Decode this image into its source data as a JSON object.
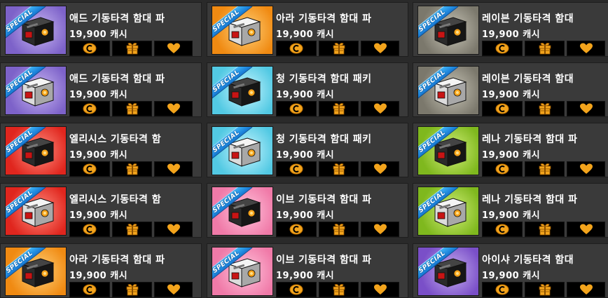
{
  "colors": {
    "accent_gold": "#f3a41c",
    "button_bg": "#000000",
    "card_bg": "#3a3a3a",
    "page_bg": "#2a2a2a",
    "ribbon_blue": "#1f8be3",
    "text_white": "#ffffff"
  },
  "ribbon_label": "SPECIAL",
  "icons": {
    "buy": "cash-coin-icon",
    "gift": "gift-box-icon",
    "wish": "heart-icon"
  },
  "products": [
    {
      "name": "애드 기동타격 함대 파",
      "price": "19,900 캐시",
      "theme": "purple",
      "box": "dark"
    },
    {
      "name": "아라 기동타격 함대 파",
      "price": "19,900 캐시",
      "theme": "orange",
      "box": "light"
    },
    {
      "name": "레이븐 기동타격 함대",
      "price": "19,900 캐시",
      "theme": "gray",
      "box": "dark"
    },
    {
      "name": "애드 기동타격 함대 파",
      "price": "19,900 캐시",
      "theme": "purple",
      "box": "light"
    },
    {
      "name": "청 기동타격 함대 패키",
      "price": "19,900 캐시",
      "theme": "cyan",
      "box": "dark"
    },
    {
      "name": "레이븐 기동타격 함대",
      "price": "19,900 캐시",
      "theme": "gray",
      "box": "light"
    },
    {
      "name": "엘리시스 기동타격 함",
      "price": "19,900 캐시",
      "theme": "red",
      "box": "dark"
    },
    {
      "name": "청 기동타격 함대 패키",
      "price": "19,900 캐시",
      "theme": "cyan",
      "box": "light"
    },
    {
      "name": "레나 기동타격 함대 파",
      "price": "19,900 캐시",
      "theme": "green",
      "box": "dark"
    },
    {
      "name": "엘리시스 기동타격 함",
      "price": "19,900 캐시",
      "theme": "red",
      "box": "light"
    },
    {
      "name": "이브 기동타격 함대 파",
      "price": "19,900 캐시",
      "theme": "pink",
      "box": "dark"
    },
    {
      "name": "레나 기동타격 함대 파",
      "price": "19,900 캐시",
      "theme": "green",
      "box": "light"
    },
    {
      "name": "아라 기동타격 함대 파",
      "price": "19,900 캐시",
      "theme": "orange",
      "box": "dark"
    },
    {
      "name": "이브 기동타격 함대 파",
      "price": "19,900 캐시",
      "theme": "pink",
      "box": "light"
    },
    {
      "name": "아이샤 기동타격 함대",
      "price": "19,900 캐시",
      "theme": "violet",
      "box": "dark"
    }
  ],
  "themes": {
    "purple": [
      "#c9b8f2",
      "#7d62c9"
    ],
    "orange": [
      "#ffd27a",
      "#f08a12"
    ],
    "gray": [
      "#c9c6b8",
      "#7b786c"
    ],
    "cyan": [
      "#c9f6ff",
      "#52c9e3"
    ],
    "red": [
      "#ff8f80",
      "#e0261e"
    ],
    "green": [
      "#d3f07a",
      "#7fb81e"
    ],
    "pink": [
      "#ffc4dc",
      "#f07aa8"
    ],
    "violet": [
      "#c7b0f0",
      "#7a4fc8"
    ]
  }
}
